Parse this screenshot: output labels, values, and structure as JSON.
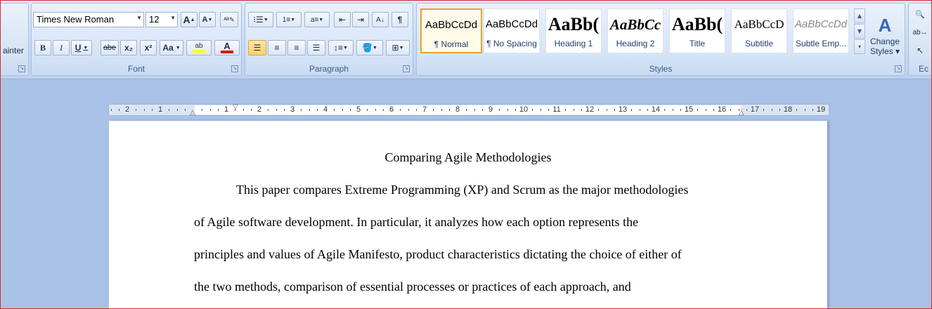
{
  "clipboard": {
    "painter_label": "ainter"
  },
  "font_group": {
    "font_name": "Times New Roman",
    "font_size": "12",
    "grow_label": "A",
    "shrink_label": "A",
    "bold_label": "B",
    "italic_label": "I",
    "underline_label": "U",
    "strike_label": "abe",
    "subscript_label": "x₂",
    "superscript_label": "x²",
    "case_label": "Aa",
    "highlight_label": "ab",
    "fontcolor_label": "A",
    "group_label": "Font"
  },
  "paragraph_group": {
    "group_label": "Paragraph",
    "pilcrow": "¶"
  },
  "styles_group": {
    "group_label": "Styles",
    "change_styles_label_1": "Change",
    "change_styles_label_2": "Styles",
    "items": [
      {
        "sample": "AaBbCcDd",
        "name": "¶ Normal"
      },
      {
        "sample": "AaBbCcDd",
        "name": "¶ No Spacing"
      },
      {
        "sample": "AaBb(",
        "name": "Heading 1"
      },
      {
        "sample": "AaBbCc",
        "name": "Heading 2"
      },
      {
        "sample": "AaBb(",
        "name": "Title"
      },
      {
        "sample": "AaBbCcD",
        "name": "Subtitle"
      },
      {
        "sample": "AaBbCcDd",
        "name": "Subtle Emp..."
      }
    ]
  },
  "editing_group": {
    "label_fragment": "Ec"
  },
  "ruler": {
    "numbers": [
      "2",
      "1",
      "1",
      "2",
      "3",
      "4",
      "5",
      "6",
      "7",
      "8",
      "9",
      "10",
      "11",
      "12",
      "13",
      "14",
      "15",
      "16",
      "17",
      "18",
      "19"
    ]
  },
  "document": {
    "title": "Comparing Agile Methodologies",
    "lines": [
      "This paper compares Extreme Programming (XP) and Scrum as the major methodologies",
      "of Agile software development. In particular, it analyzes how each option represents the",
      "principles and values of Agile Manifesto, product characteristics dictating the choice of either of",
      "the two methods,  comparison of essential processes or practices of each approach,  and"
    ]
  },
  "colors": {
    "highlight": "#ffff00",
    "font_color": "#e00000",
    "accent": "#e3a52f"
  }
}
